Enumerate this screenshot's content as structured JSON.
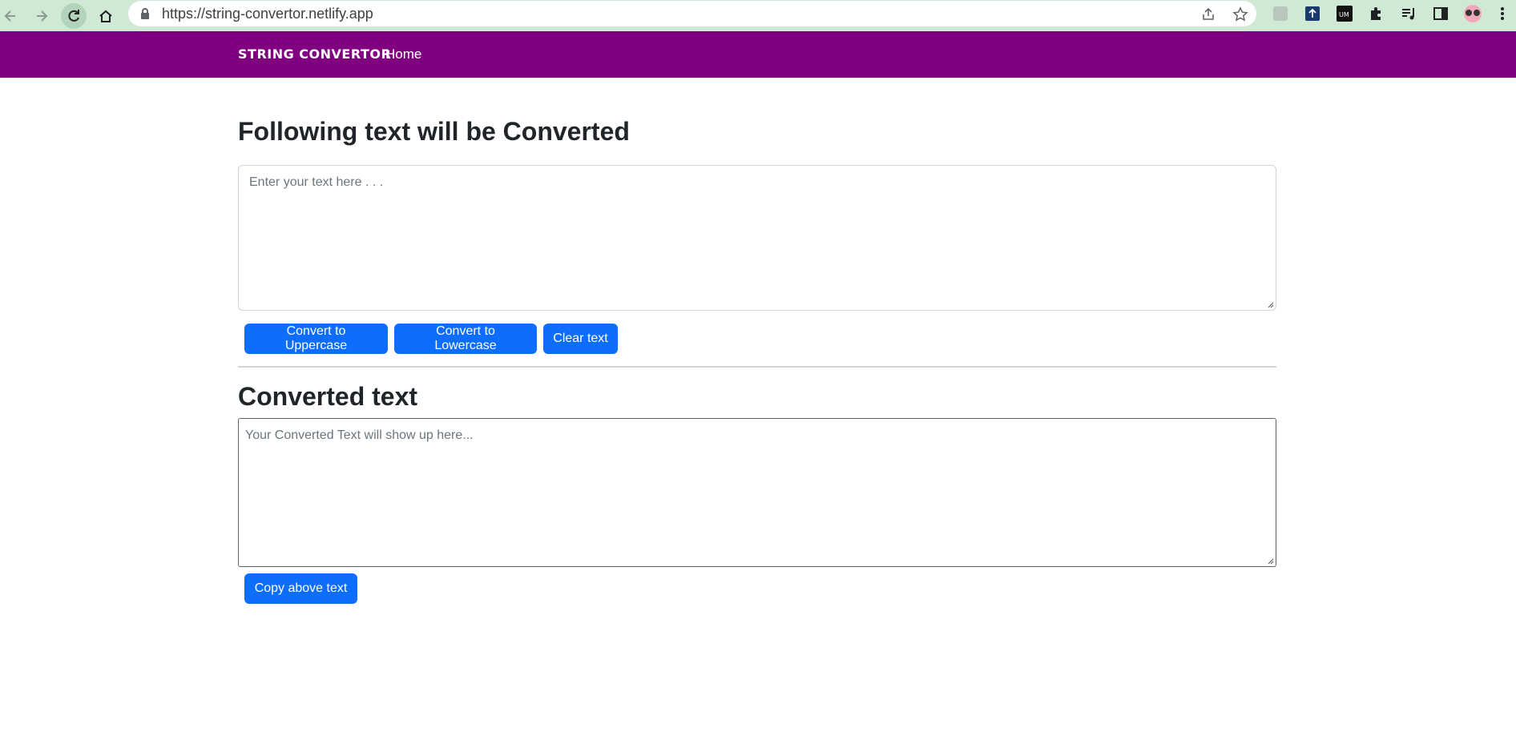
{
  "browser": {
    "url": "https://string-convertor.netlify.app"
  },
  "navbar": {
    "brand": "String Convertor",
    "home_link": "Home",
    "background": "#800080"
  },
  "main": {
    "input_heading": "Following text will be Converted",
    "input_placeholder": "Enter your text here . . .",
    "buttons": {
      "uppercase": "Convert to Uppercase",
      "lowercase": "Convert to Lowercase",
      "clear": "Clear text",
      "copy": "Copy above text"
    },
    "output_heading": "Converted text",
    "output_placeholder": "Your Converted Text will show up here..."
  },
  "colors": {
    "primary_button": "#0d6efd",
    "browser_chrome": "#cfe9d4"
  }
}
